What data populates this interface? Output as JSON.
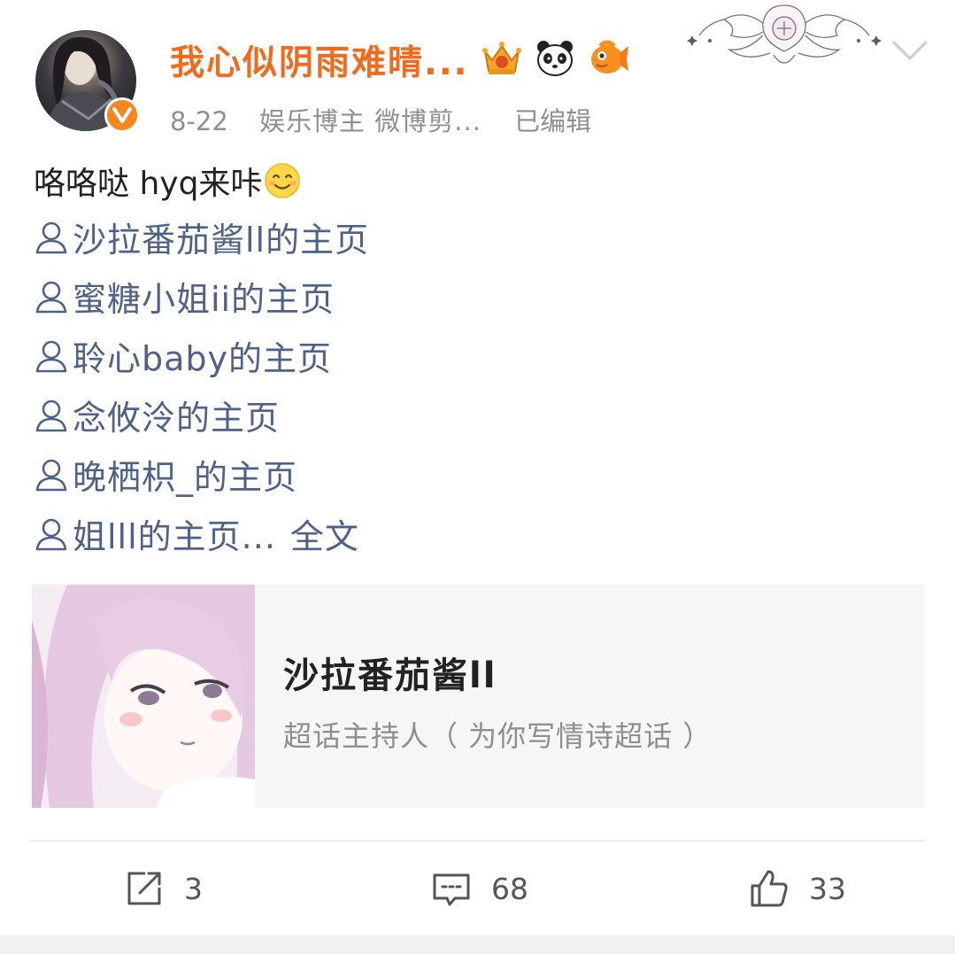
{
  "post": {
    "author": {
      "name": "我心似阴雨难晴...",
      "badges": [
        "crown-badge",
        "panda-badge",
        "orange-fish-badge"
      ],
      "verified_icon": "verified-v-icon"
    },
    "meta": {
      "date": "8-22",
      "source": "娱乐博主 微博剪...",
      "edited": "已编辑"
    },
    "text": "咯咯哒 hyq来咔",
    "mentions": [
      {
        "label": "沙拉番茄酱ll的主页"
      },
      {
        "label": "蜜糖小姐ii的主页"
      },
      {
        "label": "聆心baby的主页"
      },
      {
        "label": "念攸泠的主页"
      },
      {
        "label": "晚栖枳_的主页"
      },
      {
        "label": "姐lll的主页..."
      }
    ],
    "full_text_label": "全文",
    "card": {
      "title": "沙拉番茄酱ll",
      "subtitle": "超话主持人（ 为你写情诗超话 ）"
    },
    "actions": {
      "repost_count": "3",
      "comment_count": "68",
      "like_count": "33"
    }
  },
  "colors": {
    "username": "#f26b1d",
    "mention": "#4d6189",
    "meta": "#8f8f8f",
    "verified": "#f7861c"
  }
}
